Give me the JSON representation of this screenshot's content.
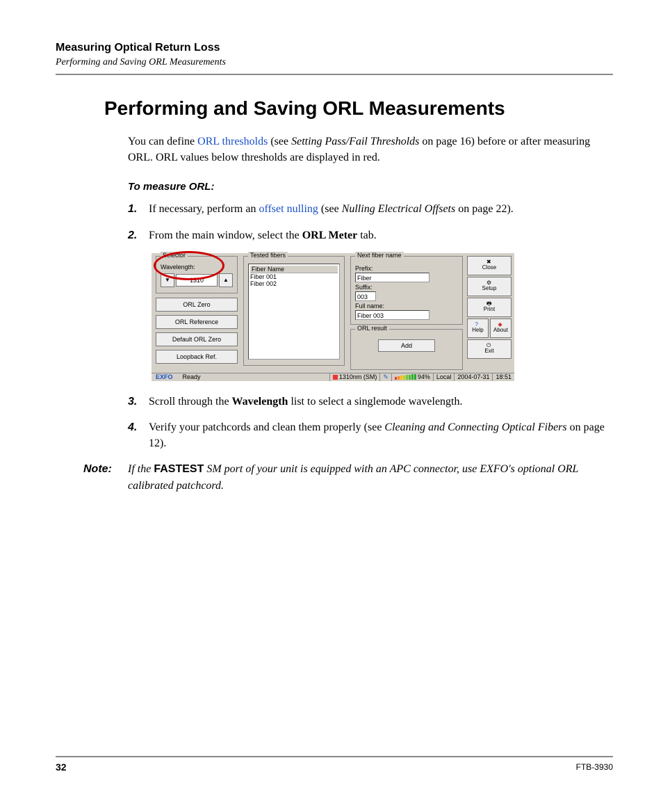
{
  "header": {
    "chapter": "Measuring Optical Return Loss",
    "section": "Performing and Saving ORL Measurements"
  },
  "title": "Performing and Saving ORL Measurements",
  "intro": {
    "t1": "You can define ",
    "link_thresholds": "ORL thresholds",
    "t2": " (see ",
    "ref1_ital": "Setting Pass/Fail Thresholds",
    "t3": " on page 16) before or after measuring ORL. ORL values below thresholds are displayed in red."
  },
  "steps_title": "To measure ORL:",
  "steps": {
    "s1": {
      "num": "1.",
      "t1": "If necessary, perform an ",
      "link": "offset nulling",
      "t2": " (see ",
      "ref_ital": "Nulling Electrical Offsets",
      "t3": " on page 22)."
    },
    "s2": {
      "num": "2.",
      "t1": "From the main window, select the ",
      "bold": "ORL Meter",
      "t2": " tab."
    },
    "s3": {
      "num": "3.",
      "t1": "Scroll through the ",
      "bold": "Wavelength",
      "t2": " list to select a singlemode wavelength."
    },
    "s4": {
      "num": "4.",
      "t1": "Verify your patchcords and clean them properly (see ",
      "ref_ital": "Cleaning and Connecting Optical Fibers",
      "t2": " on page 12)."
    }
  },
  "note": {
    "label": "Note:",
    "t1": "If the ",
    "fastest": "FASTEST",
    "t2": " SM port of your unit is equipped with an APC connector, use EXFO's optional ORL calibrated patchcord."
  },
  "screenshot": {
    "selector": {
      "group": "Selector",
      "wavelength_label": "Wavelength:",
      "wavelength_value": "1310",
      "buttons": {
        "orl_zero": "ORL Zero",
        "orl_reference": "ORL Reference",
        "default_orl_zero": "Default ORL Zero",
        "loopback_ref": "Loopback Ref."
      }
    },
    "tested_fibers": {
      "group": "Tested fibers",
      "header": "Fiber Name",
      "rows": [
        "Fiber 001",
        "Fiber 002"
      ]
    },
    "next_fiber": {
      "group": "Next fiber name",
      "prefix_label": "Prefix:",
      "prefix_value": "Fiber",
      "suffix_label": "Suffix:",
      "suffix_value": "003",
      "fullname_label": "Full name:",
      "fullname_value": "Fiber 003"
    },
    "orl_result": {
      "group": "ORL result",
      "add": "Add"
    },
    "side": {
      "close": "Close",
      "setup": "Setup",
      "print": "Print",
      "help": "Help",
      "about": "About",
      "exit": "Exit"
    },
    "status": {
      "brand": "EXFO",
      "ready": "Ready",
      "wavelength": "1310nm (SM)",
      "percent": "94%",
      "local": "Local",
      "date": "2004-07-31",
      "time": "18:51"
    }
  },
  "footer": {
    "page": "32",
    "doc": "FTB-3930"
  }
}
